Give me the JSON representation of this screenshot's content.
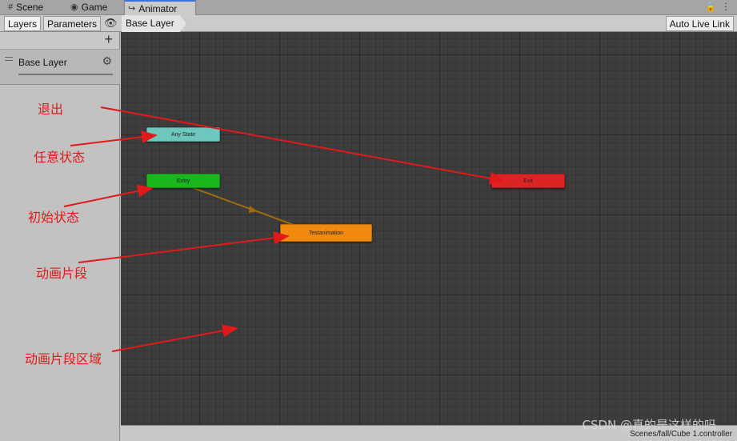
{
  "tabs": [
    {
      "label": "Scene",
      "icon": "grid-icon"
    },
    {
      "label": "Game",
      "icon": "gamepad-icon"
    },
    {
      "label": "Animator",
      "icon": "animator-icon"
    }
  ],
  "toolbar": {
    "layers_label": "Layers",
    "parameters_label": "Parameters",
    "breadcrumb": "Base Layer",
    "auto_live_link": "Auto Live Link"
  },
  "left_panel": {
    "layer_name": "Base Layer"
  },
  "graph": {
    "nodes": {
      "any_state": "Any State",
      "entry": "Entry",
      "exit": "Exit",
      "clip": "Testanimation"
    },
    "path": "Scenes/fall/Cube 1.controller"
  },
  "annotations": {
    "exit": "退出",
    "any_state": "任意状态",
    "initial_state": "初始状态",
    "clip": "动画片段",
    "clip_area": "动画片段区域"
  },
  "watermark": "CSDN @真的是这样的吗",
  "colors": {
    "any_state": "#6dc7bd",
    "entry": "#19b61e",
    "exit": "#dd2424",
    "clip": "#f08a0f",
    "annotation": "#e01a1a",
    "active_tab_accent": "#3a72d8"
  }
}
